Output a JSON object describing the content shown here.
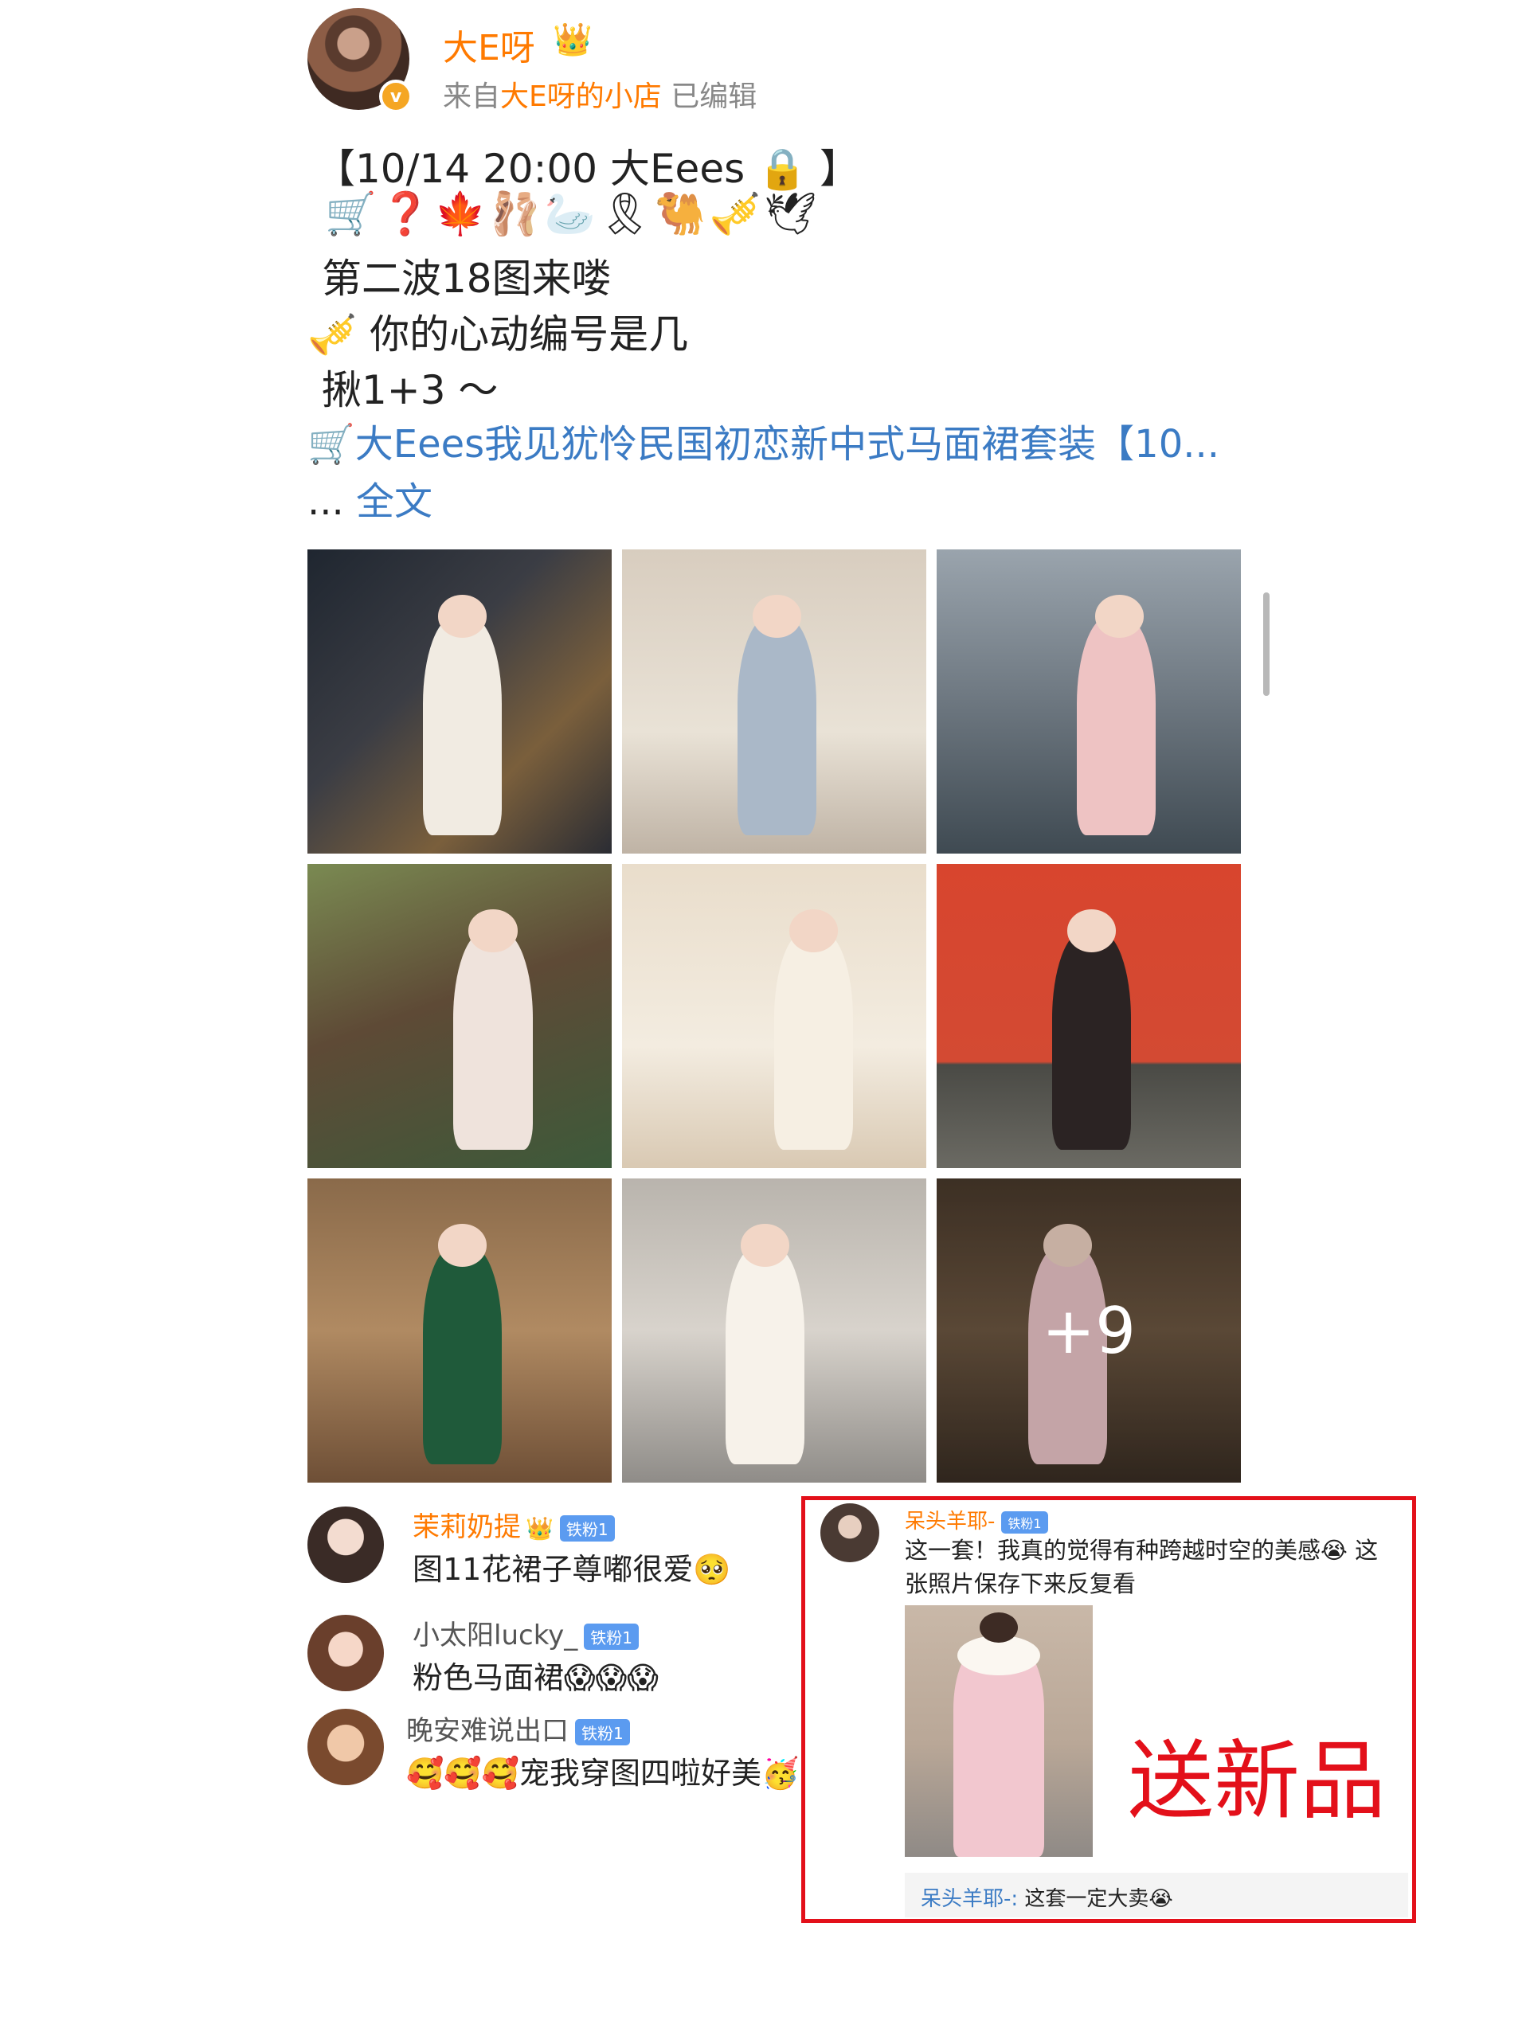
{
  "header": {
    "username": "大E呀",
    "crown_icon": "👑",
    "verified_icon": "v",
    "source_prefix": "来自",
    "source_shop": "大E呀的小店",
    "edited": "已编辑"
  },
  "post": {
    "line1": "【10/14 20:00 大Eees 🔒 】",
    "emoji_line": "🛒❓🍁🩰🦢🎗🐫🎺🕊",
    "line2": "第二波18图来喽",
    "line3": "🎺   你的心动编号是几",
    "line4": "揪1+3  ～",
    "link_text": "🛒大Eees我见犹怜民国初恋新中式马面裙套装【10...",
    "ellipsis": "... ",
    "full_text": "全文"
  },
  "gallery": {
    "more_count": "+9"
  },
  "comments": [
    {
      "name": "茉莉奶提",
      "badge": "铁粉1",
      "crown": "👑",
      "text": "图11花裙子尊嘟很爱🥺"
    },
    {
      "name": "小太阳lucky_",
      "badge": "铁粉1",
      "text": "粉色马面裙😱😱😱"
    },
    {
      "name": "晚安难说出口",
      "badge": "铁粉1",
      "text": "🥰🥰🥰宠我穿图四啦好美🥳"
    }
  ],
  "highlight": {
    "name": "呆头羊耶-",
    "badge": "铁粉1",
    "text": "这一套！我真的觉得有种跨越时空的美感😭 这张照片保存下来反复看",
    "stamp": "送新品",
    "reply_name": "呆头羊耶-:",
    "reply_text": " 这套一定大卖😭",
    "border_color": "#e3101a"
  },
  "colors": {
    "accent_orange": "#ff7a00",
    "link_blue": "#3b7bc4",
    "highlight_red": "#e3101a"
  }
}
